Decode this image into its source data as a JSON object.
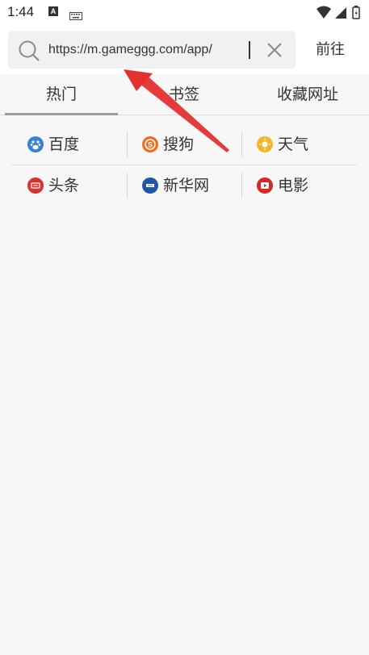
{
  "status_bar": {
    "time": "1:44",
    "icons": [
      "text-a-icon",
      "keyboard-icon",
      "wifi-icon",
      "signal-icon",
      "battery-icon"
    ]
  },
  "address_bar": {
    "url_value": "https://m.gameggg.com/app/",
    "go_label": "前往",
    "icons": [
      "search-icon",
      "clear-icon"
    ]
  },
  "tabs": [
    {
      "label": "热门",
      "active": true
    },
    {
      "label": "书签",
      "active": false
    },
    {
      "label": "收藏网址",
      "active": false
    }
  ],
  "sites": [
    {
      "label": "百度",
      "icon": "baidu-icon",
      "color": "#3a7fd6"
    },
    {
      "label": "搜狗",
      "icon": "sogou-icon",
      "color": "#f26b1d"
    },
    {
      "label": "天气",
      "icon": "weather-icon",
      "color": "#f6b42a"
    },
    {
      "label": "头条",
      "icon": "toutiao-icon",
      "color": "#d6322e"
    },
    {
      "label": "新华网",
      "icon": "xinhua-icon",
      "color": "#1f56a8"
    },
    {
      "label": "电影",
      "icon": "movie-icon",
      "color": "#d62828"
    }
  ],
  "colors": {
    "annotation_arrow": "#e53030",
    "tab_indicator": "#9e9e9e",
    "background": "#f7f7f7"
  }
}
